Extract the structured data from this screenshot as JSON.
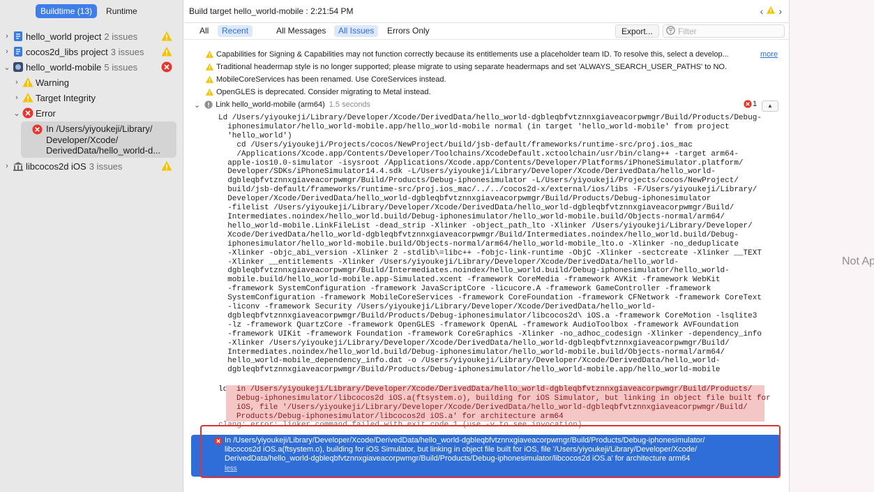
{
  "navigator": {
    "tabs": [
      {
        "label": "Buildtime (13)",
        "active": true
      },
      {
        "label": "Runtime",
        "active": false
      }
    ],
    "tree": [
      {
        "name": "hello_world project",
        "count": "2 issues",
        "status": "warning"
      },
      {
        "name": "cocos2d_libs project",
        "count": "3 issues",
        "status": "warning"
      },
      {
        "name": "hello_world-mobile",
        "count": "5 issues",
        "status": "error"
      },
      {
        "name": "Warning"
      },
      {
        "name": "Target Integrity"
      },
      {
        "name": "Error"
      },
      {
        "name": "libcocos2d iOS",
        "count": "3 issues",
        "status": "warning"
      }
    ],
    "selected_issue": "In /Users/yiyoukeji/Library/\nDeveloper/Xcode/\nDerivedData/hello_world-d..."
  },
  "main": {
    "title": "Build target hello_world-mobile : 2:21:54 PM",
    "filters": {
      "scope": [
        "All",
        "Recent"
      ],
      "kinds": [
        "All Messages",
        "All Issues",
        "Errors Only"
      ],
      "export_label": "Export...",
      "filter_placeholder": "Filter"
    },
    "warnings": [
      "Capabilities for Signing & Capabilities may not function correctly because its entitlements use a placeholder team ID. To resolve this, select a develop...",
      "Traditional headermap style is no longer supported; please migrate to using separate headermaps and set 'ALWAYS_SEARCH_USER_PATHS' to NO.",
      "MobileCoreServices has been renamed. Use CoreServices instead.",
      "OpenGLES is deprecated. Consider migrating to Metal instead."
    ],
    "more_label": "more",
    "link_step": {
      "label": "Link hello_world-mobile (arm64)",
      "elapsed": "1.5 seconds",
      "error_count": "1"
    },
    "log_command": "Ld /Users/yiyoukeji/Library/Developer/Xcode/DerivedData/hello_world-dgbleqbfvtznnxgiaveacorpwmgr/Build/Products/Debug-\n  iphonesimulator/hello_world-mobile.app/hello_world-mobile normal (in target 'hello_world-mobile' from project\n  'hello_world')\n    cd /Users/yiyoukeji/Projects/cocos/NewProject/build/jsb-default/frameworks/runtime-src/proj.ios_mac\n    /Applications/Xcode.app/Contents/Developer/Toolchains/XcodeDefault.xctoolchain/usr/bin/clang++ -target arm64-\n  apple-ios10.0-simulator -isysroot /Applications/Xcode.app/Contents/Developer/Platforms/iPhoneSimulator.platform/\n  Developer/SDKs/iPhoneSimulator14.4.sdk -L/Users/yiyoukeji/Library/Developer/Xcode/DerivedData/hello_world-\n  dgbleqbfvtznnxgiaveacorpwmgr/Build/Products/Debug-iphonesimulator -L/Users/yiyoukeji/Projects/cocos/NewProject/\n  build/jsb-default/frameworks/runtime-src/proj.ios_mac/../../cocos2d-x/external/ios/libs -F/Users/yiyoukeji/Library/\n  Developer/Xcode/DerivedData/hello_world-dgbleqbfvtznnxgiaveacorpwmgr/Build/Products/Debug-iphonesimulator\n  -filelist /Users/yiyoukeji/Library/Developer/Xcode/DerivedData/hello_world-dgbleqbfvtznnxgiaveacorpwmgr/Build/\n  Intermediates.noindex/hello_world.build/Debug-iphonesimulator/hello_world-mobile.build/Objects-normal/arm64/\n  hello_world-mobile.LinkFileList -dead_strip -Xlinker -object_path_lto -Xlinker /Users/yiyoukeji/Library/Developer/\n  Xcode/DerivedData/hello_world-dgbleqbfvtznnxgiaveacorpwmgr/Build/Intermediates.noindex/hello_world.build/Debug-\n  iphonesimulator/hello_world-mobile.build/Objects-normal/arm64/hello_world-mobile_lto.o -Xlinker -no_deduplicate\n  -Xlinker -objc_abi_version -Xlinker 2 -stdlib\\=libc++ -fobjc-link-runtime -ObjC -Xlinker -sectcreate -Xlinker __TEXT\n  -Xlinker __entitlements -Xlinker /Users/yiyoukeji/Library/Developer/Xcode/DerivedData/hello_world-\n  dgbleqbfvtznnxgiaveacorpwmgr/Build/Intermediates.noindex/hello_world.build/Debug-iphonesimulator/hello_world-\n  mobile.build/hello_world-mobile.app-Simulated.xcent -framework CoreMedia -framework AVKit -framework WebKit\n  -framework SystemConfiguration -framework JavaScriptCore -licucore.A -framework GameController -framework\n  SystemConfiguration -framework MobileCoreServices -framework CoreFoundation -framework CFNetwork -framework CoreText\n  -liconv -framework Security /Users/yiyoukeji/Library/Developer/Xcode/DerivedData/hello_world-\n  dgbleqbfvtznnxgiaveacorpwmgr/Build/Products/Debug-iphonesimulator/libcocos2d\\ iOS.a -framework CoreMotion -lsqlite3\n  -lz -framework QuartzCore -framework OpenGLES -framework OpenAL -framework AudioToolbox -framework AVFoundation\n  -framework UIKit -framework Foundation -framework CoreGraphics -Xlinker -no_adhoc_codesign -Xlinker -dependency_info\n  -Xlinker /Users/yiyoukeji/Library/Developer/Xcode/DerivedData/hello_world-dgbleqbfvtznnxgiaveacorpwmgr/Build/\n  Intermediates.noindex/hello_world.build/Debug-iphonesimulator/hello_world-mobile.build/Objects-normal/arm64/\n  hello_world-mobile_dependency_info.dat -o /Users/yiyoukeji/Library/Developer/Xcode/DerivedData/hello_world-\n  dgbleqbfvtznnxgiaveacorpwmgr/Build/Products/Debug-iphonesimulator/hello_world-mobile.app/hello_world-mobile",
    "ld_prefix": "ld:",
    "ld_error": "in /Users/yiyoukeji/Library/Developer/Xcode/DerivedData/hello_world-dgbleqbfvtznnxgiaveacorpwmgr/Build/Products/\nDebug-iphonesimulator/libcocos2d iOS.a(ftsystem.o), building for iOS Simulator, but linking in object file built for\niOS, file '/Users/yiyoukeji/Library/Developer/Xcode/DerivedData/hello_world-dgbleqbfvtznnxgiaveacorpwmgr/Build/\nProducts/Debug-iphonesimulator/libcocos2d iOS.a' for architecture arm64",
    "clang_line": "clang: error: linker command failed with exit code 1 (use -v to see invocation)",
    "selected_issue": "In /Users/yiyoukeji/Library/Developer/Xcode/DerivedData/hello_world-dgbleqbfvtznnxgiaveacorpwmgr/Build/Products/Debug-iphonesimulator/\nlibcocos2d iOS.a(ftsystem.o), building for iOS Simulator, but linking in object file built for iOS, file '/Users/yiyoukeji/Library/Developer/Xcode/\nDerivedData/hello_world-dgbleqbfvtznnxgiaveacorpwmgr/Build/Products/Debug-iphonesimulator/libcocos2d iOS.a' for architecture arm64",
    "less_label": "less"
  },
  "right_panel": {
    "placeholder": "Not Ap"
  },
  "colors": {
    "accent": "#3f7ee8",
    "selection_blue": "#2f6ed9",
    "warning_yellow": "#f5c200",
    "error_red": "#e5352d",
    "ld_error_bg": "#f5c6c6",
    "highlight_outline": "#e0322e"
  },
  "icons": {
    "project": "xcode-project-icon",
    "target": "app-target-icon",
    "library": "library-building-icon",
    "warning": "warning-triangle-icon",
    "error": "error-circle-icon"
  }
}
